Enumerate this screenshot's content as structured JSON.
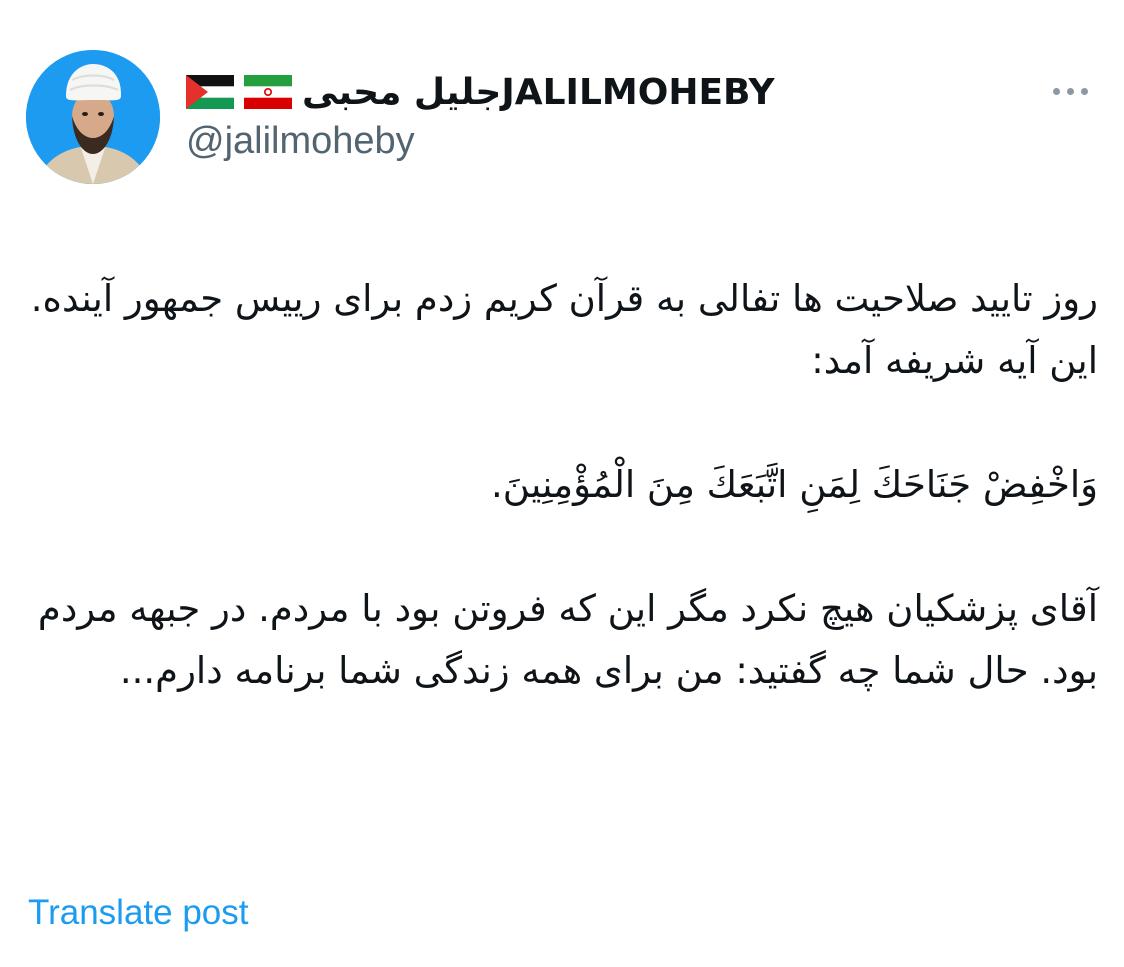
{
  "tweet": {
    "author": {
      "display_name": "جلیل محبیJALILMOHEBY",
      "handle": "@jalilmoheby",
      "avatar": "avatar-photo",
      "flags": [
        "iran-flag",
        "palestine-flag"
      ]
    },
    "more_icon": "ellipsis-icon",
    "body": {
      "paragraph_1": "روز تایید صلاحیت ها تفالی به قرآن کریم زدم برای رییس جمهور آینده. این آیه شریفه آمد:",
      "paragraph_2": "وَاخْفِضْ جَنَاحَكَ لِمَنِ اتَّبَعَكَ مِنَ الْمُؤْمِنِينَ.",
      "paragraph_3": "آقای پزشکیان هیچ نکرد مگر این که فروتن بود با مردم. در جبهه مردم بود. حال شما چه گفتید: من برای همه زندگی شما برنامه دارم..."
    },
    "translate_label": "Translate post",
    "colors": {
      "link": "#1d9bf0",
      "text": "#0f1419",
      "secondary": "#536471",
      "avatar_bg": "#1d9bf0"
    }
  }
}
